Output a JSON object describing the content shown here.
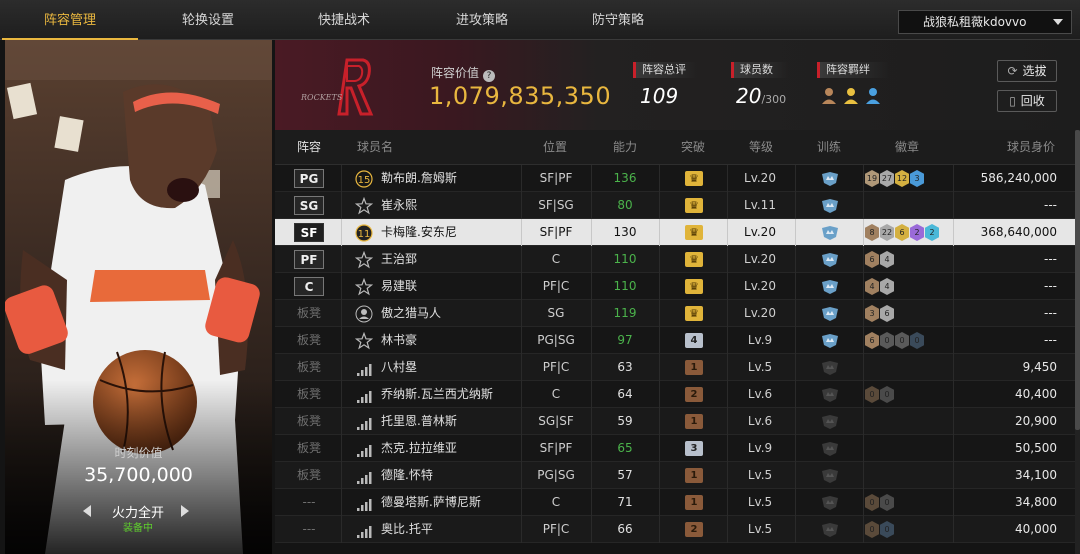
{
  "nav": {
    "tabs": [
      {
        "label": "阵容管理",
        "active": true
      },
      {
        "label": "轮换设置",
        "active": false
      },
      {
        "label": "快捷战术",
        "active": false
      },
      {
        "label": "进攻策略",
        "active": false
      },
      {
        "label": "防守策略",
        "active": false
      }
    ],
    "account": "战狼私租薇kdovvo"
  },
  "card": {
    "value_label": "时刻价值",
    "value": "35,700,000",
    "mode": "火力全开",
    "mode_status": "装备中"
  },
  "team": {
    "logo_text": "ROCKETS",
    "value_label": "阵容价值",
    "value": "1,079,835,350",
    "rating_label": "阵容总评",
    "rating": "109",
    "count_label": "球员数",
    "count": "20",
    "count_max": "/300",
    "bond_label": "阵容羁绊",
    "pick_button": "选拔",
    "recycle_button": "回收"
  },
  "colors": {
    "accent": "#e9b73f",
    "green": "#4bb34b",
    "red": "#c8202a"
  },
  "table": {
    "headers": {
      "lineup": "阵容",
      "name": "球员名",
      "pos": "位置",
      "ability": "能力",
      "breakthrough": "突破",
      "level": "等级",
      "training": "训练",
      "badge": "徽章",
      "worth": "球员身价"
    },
    "rows": [
      {
        "slot": "PG",
        "starter": true,
        "jersey": "15",
        "jersey_icon": "number-jersey-icon",
        "name": "勒布朗.詹姆斯",
        "pos": "SF|PF",
        "ability": "136",
        "green": true,
        "brk": "",
        "brk_type": "gold",
        "level": "Lv.20",
        "badges": [
          {
            "t": "19",
            "c": "#b09878"
          },
          {
            "t": "27",
            "c": "#a8a8a8"
          },
          {
            "t": "12",
            "c": "#d4b040"
          },
          {
            "t": "3",
            "c": "#4a9ad8"
          }
        ],
        "worth": "586,240,000"
      },
      {
        "slot": "SG",
        "starter": true,
        "jersey": "",
        "jersey_icon": "star-icon",
        "name": "崔永熙",
        "pos": "SF|SG",
        "ability": "80",
        "green": true,
        "brk": "",
        "brk_type": "gold",
        "level": "Lv.11",
        "badges": [],
        "worth": "---"
      },
      {
        "slot": "SF",
        "starter": true,
        "selected": true,
        "jersey": "11",
        "jersey_icon": "number-jersey-icon",
        "name": "卡梅隆.安东尼",
        "pos": "SF|PF",
        "ability": "130",
        "green": false,
        "brk": "",
        "brk_type": "gold",
        "level": "Lv.20",
        "badges": [
          {
            "t": "8",
            "c": "#a08060"
          },
          {
            "t": "22",
            "c": "#a8a8a8"
          },
          {
            "t": "6",
            "c": "#d4b040"
          },
          {
            "t": "2",
            "c": "#9a6ad8"
          },
          {
            "t": "2",
            "c": "#4ab8d8"
          }
        ],
        "worth": "368,640,000"
      },
      {
        "slot": "PF",
        "starter": true,
        "jersey": "",
        "jersey_icon": "star-icon",
        "name": "王治郅",
        "pos": "C",
        "ability": "110",
        "green": true,
        "brk": "",
        "brk_type": "gold",
        "level": "Lv.20",
        "badges": [
          {
            "t": "6",
            "c": "#a08060"
          },
          {
            "t": "4",
            "c": "#a8a8a8"
          }
        ],
        "worth": "---"
      },
      {
        "slot": "C",
        "starter": true,
        "jersey": "",
        "jersey_icon": "star-icon",
        "name": "易建联",
        "pos": "PF|C",
        "ability": "110",
        "green": true,
        "brk": "",
        "brk_type": "gold",
        "level": "Lv.20",
        "badges": [
          {
            "t": "4",
            "c": "#a08060"
          },
          {
            "t": "4",
            "c": "#a8a8a8"
          }
        ],
        "worth": "---"
      },
      {
        "slot": "板凳",
        "starter": false,
        "jersey": "",
        "jersey_icon": "person-icon",
        "name": "傲之猎马人",
        "pos": "SG",
        "ability": "119",
        "green": true,
        "brk": "",
        "brk_type": "gold",
        "level": "Lv.20",
        "badges": [
          {
            "t": "3",
            "c": "#a08060"
          },
          {
            "t": "6",
            "c": "#a8a8a8"
          }
        ],
        "worth": "---"
      },
      {
        "slot": "板凳",
        "starter": false,
        "jersey": "",
        "jersey_icon": "star-icon",
        "name": "林书豪",
        "pos": "PG|SG",
        "ability": "97",
        "green": true,
        "brk": "4",
        "brk_type": "silver",
        "level": "Lv.9",
        "badges": [
          {
            "t": "6",
            "c": "#a08060"
          },
          {
            "t": "0",
            "c": "#5a5a5a"
          },
          {
            "t": "0",
            "c": "#5a5a5a"
          },
          {
            "t": "0",
            "c": "#3a4a5a"
          }
        ],
        "worth": "---"
      },
      {
        "slot": "板凳",
        "starter": false,
        "jersey": "",
        "jersey_icon": "signal-bars-icon",
        "name": "八村塁",
        "pos": "PF|C",
        "ability": "63",
        "green": false,
        "brk": "1",
        "brk_type": "bronze",
        "level": "Lv.5",
        "badges": [],
        "worth": "9,450"
      },
      {
        "slot": "板凳",
        "starter": false,
        "jersey": "",
        "jersey_icon": "signal-bars-icon",
        "name": "乔纳斯.瓦兰西尤纳斯",
        "pos": "C",
        "ability": "64",
        "green": false,
        "brk": "2",
        "brk_type": "bronze",
        "level": "Lv.6",
        "badges": [
          {
            "t": "0",
            "c": "#5a4a3a"
          },
          {
            "t": "0",
            "c": "#4a4a4a"
          }
        ],
        "worth": "40,400"
      },
      {
        "slot": "板凳",
        "starter": false,
        "jersey": "",
        "jersey_icon": "signal-bars-icon",
        "name": "托里恩.普林斯",
        "pos": "SG|SF",
        "ability": "59",
        "green": false,
        "brk": "1",
        "brk_type": "bronze",
        "level": "Lv.6",
        "badges": [],
        "worth": "20,900"
      },
      {
        "slot": "板凳",
        "starter": false,
        "jersey": "",
        "jersey_icon": "signal-bars-icon",
        "name": "杰克.拉拉维亚",
        "pos": "SF|PF",
        "ability": "65",
        "green": true,
        "brk": "3",
        "brk_type": "silver",
        "level": "Lv.9",
        "badges": [],
        "worth": "50,500"
      },
      {
        "slot": "板凳",
        "starter": false,
        "jersey": "",
        "jersey_icon": "signal-bars-icon",
        "name": "德隆.怀特",
        "pos": "PG|SG",
        "ability": "57",
        "green": false,
        "brk": "1",
        "brk_type": "bronze",
        "level": "Lv.5",
        "badges": [],
        "worth": "34,100"
      },
      {
        "slot": "---",
        "starter": false,
        "jersey": "",
        "jersey_icon": "signal-bars-icon",
        "name": "德曼塔斯.萨博尼斯",
        "pos": "C",
        "ability": "71",
        "green": false,
        "brk": "1",
        "brk_type": "bronze",
        "level": "Lv.5",
        "badges": [
          {
            "t": "0",
            "c": "#5a4a3a"
          },
          {
            "t": "0",
            "c": "#4a4a4a"
          }
        ],
        "worth": "34,800"
      },
      {
        "slot": "---",
        "starter": false,
        "jersey": "",
        "jersey_icon": "signal-bars-icon",
        "name": "奥比.托平",
        "pos": "PF|C",
        "ability": "66",
        "green": false,
        "brk": "2",
        "brk_type": "bronze",
        "level": "Lv.5",
        "badges": [
          {
            "t": "0",
            "c": "#5a4a3a"
          },
          {
            "t": "0",
            "c": "#3a4a5a"
          }
        ],
        "worth": "40,000"
      }
    ]
  }
}
